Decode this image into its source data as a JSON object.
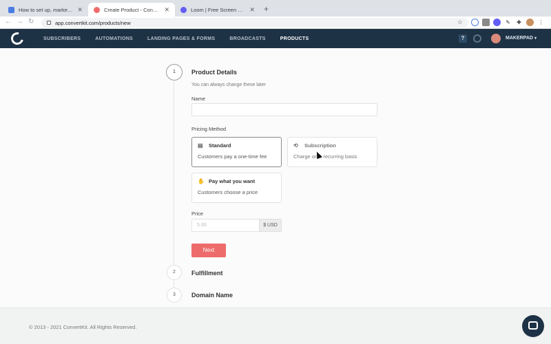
{
  "browser": {
    "tabs": [
      {
        "label": "How to set up, market and run",
        "favicon_color": "#4a7de4"
      },
      {
        "label": "Create Product - ConvertKit",
        "favicon_color": "#f06c6c"
      },
      {
        "label": "Loom | Free Screen & Video Re",
        "favicon_color": "#625df5"
      }
    ],
    "new_tab": "+",
    "url": "app.convertkit.com/products/new"
  },
  "appnav": {
    "links": [
      "SUBSCRIBERS",
      "AUTOMATIONS",
      "LANDING PAGES & FORMS",
      "BROADCASTS",
      "PRODUCTS"
    ],
    "active": "PRODUCTS",
    "help": "?",
    "user": "MAKERPAD"
  },
  "form": {
    "steps": [
      {
        "number": "1",
        "title": "Product Details"
      },
      {
        "number": "2",
        "title": "Fulfillment"
      },
      {
        "number": "3",
        "title": "Domain Name"
      }
    ],
    "subtitle": "You can always change these later",
    "name_label": "Name",
    "name_value": "",
    "pricing_label": "Pricing Method",
    "pricing_options": [
      {
        "title": "Standard",
        "description": "Customers pay a one-time fee",
        "icon": "document-icon",
        "selected": true
      },
      {
        "title": "Subscription",
        "description": "Charge on a recurring basis",
        "icon": "repeat-icon",
        "selected": false
      },
      {
        "title": "Pay what you want",
        "description": "Customers choose a price",
        "icon": "hand-coin-icon",
        "selected": false
      }
    ],
    "price_label": "Price",
    "price_placeholder": "5.00",
    "price_unit": "$ USD",
    "next_label": "Next"
  },
  "footer": {
    "copyright": "© 2013 - 2021 ConvertKit. All Rights Reserved."
  },
  "colors": {
    "nav_bg": "#1e3246",
    "accent": "#ee6b6b"
  }
}
